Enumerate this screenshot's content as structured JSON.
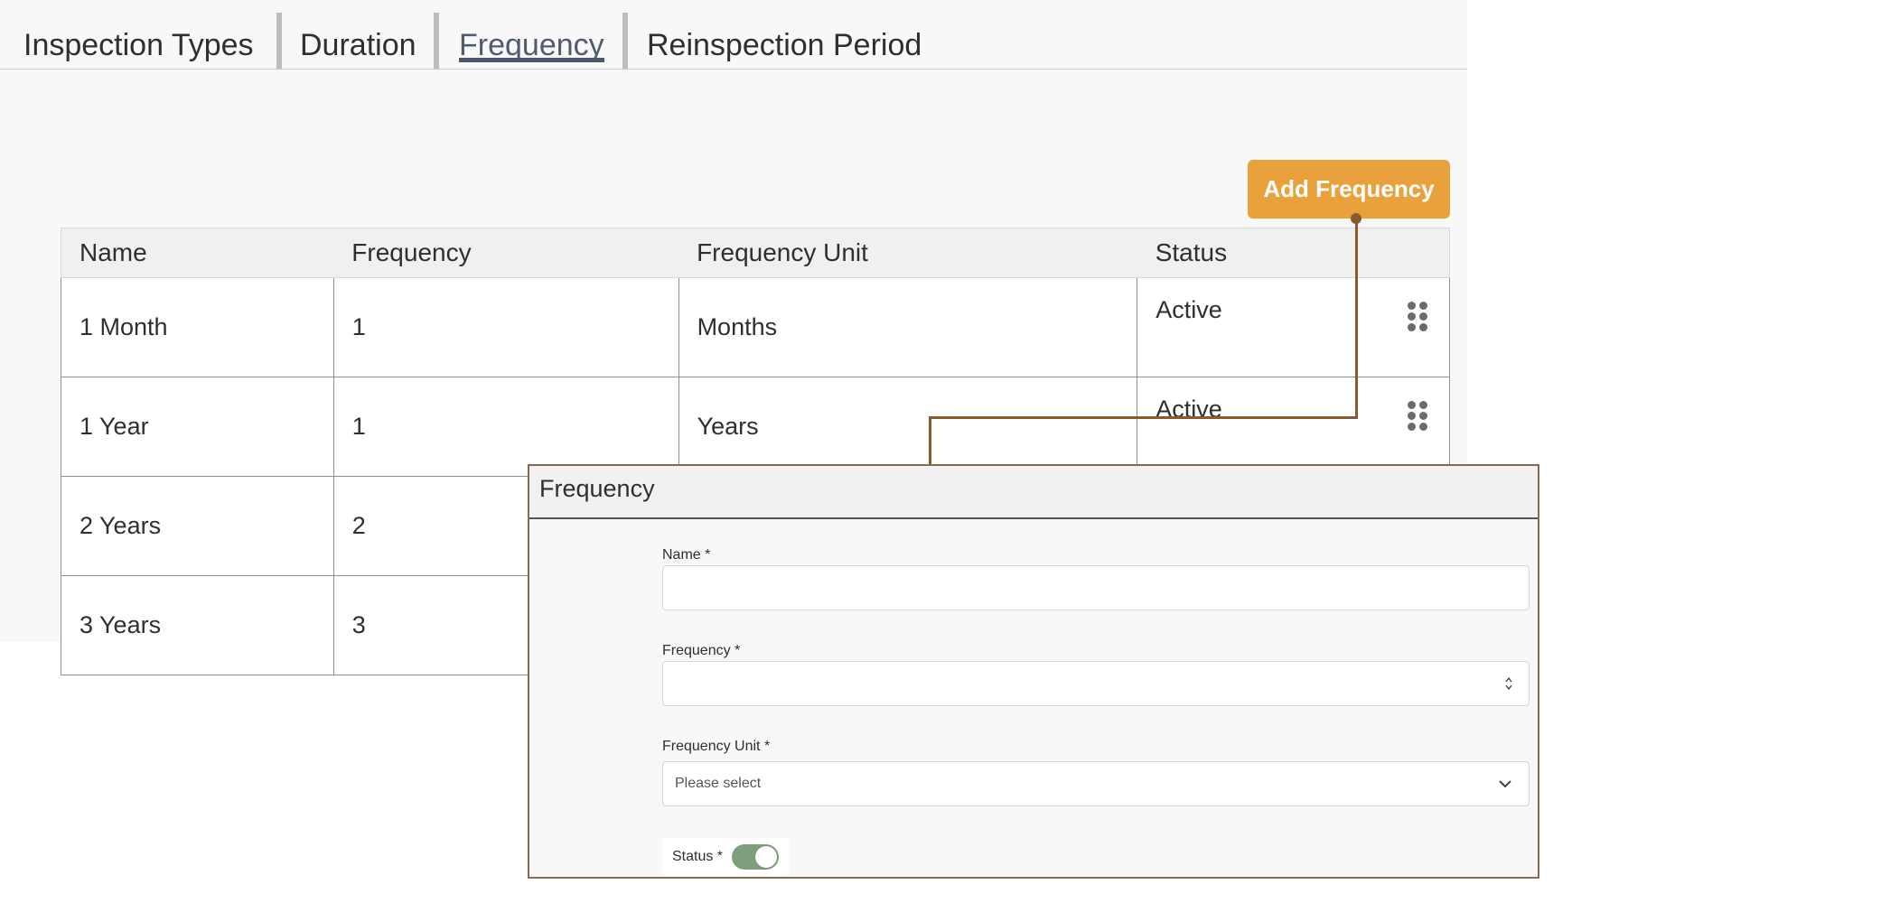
{
  "tabs": [
    {
      "label": "Inspection Types"
    },
    {
      "label": "Duration"
    },
    {
      "label": "Frequency",
      "active": true
    },
    {
      "label": "Reinspection Period"
    }
  ],
  "add_button_label": "Add Frequency",
  "table": {
    "headers": [
      "Name",
      "Frequency",
      "Frequency Unit",
      "Status"
    ],
    "rows": [
      {
        "name": "1 Month",
        "frequency": "1",
        "unit": "Months",
        "status": "Active"
      },
      {
        "name": "1 Year",
        "frequency": "1",
        "unit": "Years",
        "status": "Active"
      },
      {
        "name": "2 Years",
        "frequency": "2",
        "unit": "",
        "status": ""
      },
      {
        "name": "3 Years",
        "frequency": "3",
        "unit": "",
        "status": ""
      }
    ]
  },
  "modal": {
    "title": "Frequency",
    "name_label": "Name *",
    "name_value": "",
    "frequency_label": "Frequency *",
    "frequency_value": "",
    "unit_label": "Frequency Unit *",
    "unit_placeholder": "Please select",
    "status_label": "Status *",
    "status_on": true
  },
  "colors": {
    "accent": "#e9a23b",
    "connector": "#8a5a2f",
    "toggle_on": "#7e9f7c",
    "active_tab": "#505669"
  },
  "icons": [
    "drag-handle-icon",
    "chevron-down-icon",
    "number-spinner-icon"
  ]
}
